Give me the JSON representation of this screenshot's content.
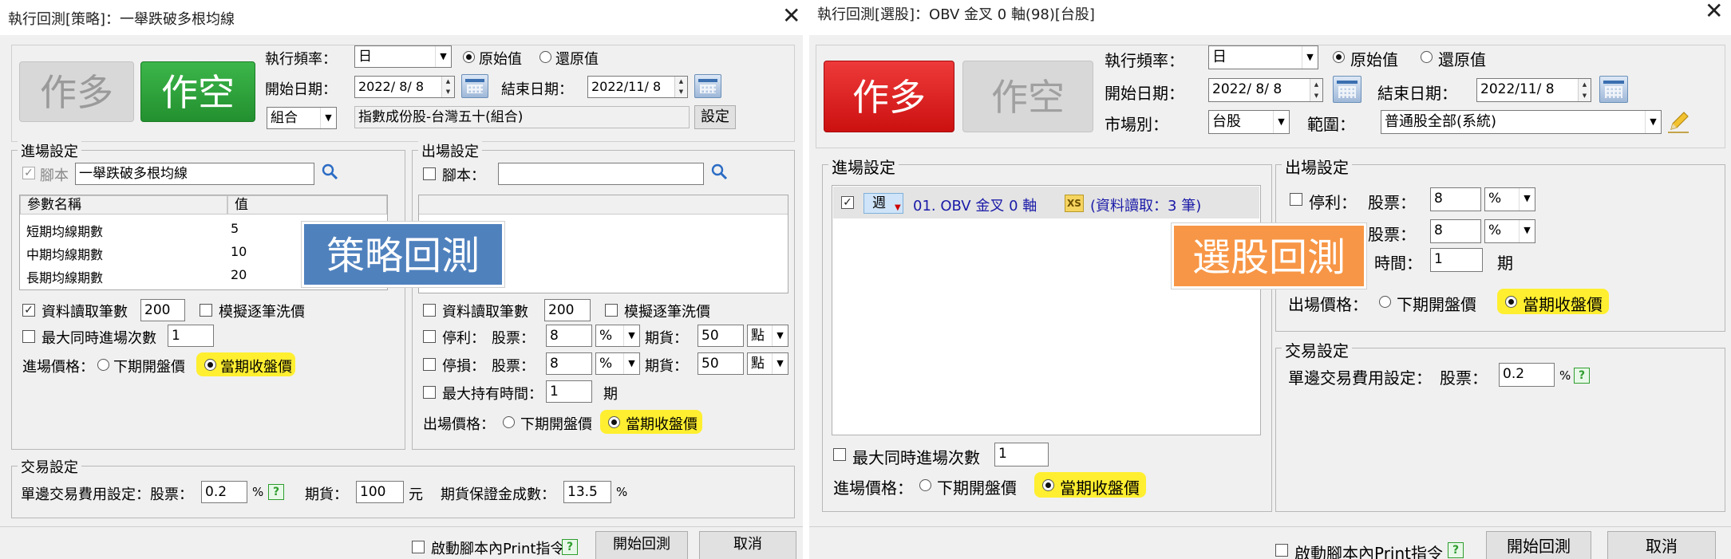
{
  "left": {
    "title": "執行回測[策略]：一舉跌破多根均線",
    "btn_long": "作多",
    "btn_short": "作空",
    "freq_label": "執行頻率：",
    "freq_value": "日",
    "radio_original": "原始值",
    "radio_restore": "還原值",
    "start_label": "開始日期：",
    "start_value": "2022/ 8/ 8",
    "end_label": "結束日期：",
    "end_value": "2022/11/ 8",
    "combo_value": "組合",
    "index_value": "指數成份股-台灣五十(組合)",
    "setting_btn": "設定",
    "entry": {
      "title": "進場設定",
      "script_label": "腳本",
      "script_value": "一舉跌破多根均線",
      "col_name": "參數名稱",
      "col_value": "值",
      "params": [
        {
          "name": "短期均線期數",
          "value": "5"
        },
        {
          "name": "中期均線期數",
          "value": "10"
        },
        {
          "name": "長期均線期數",
          "value": "20"
        }
      ],
      "read_label": "資料讀取筆數",
      "read_value": "200",
      "simulate_label": "模擬逐筆洗價",
      "max_label": "最大同時進場次數",
      "max_value": "1",
      "price_label": "進場價格：",
      "price_next": "下期開盤價",
      "price_close": "當期收盤價"
    },
    "exit": {
      "title": "出場設定",
      "script_label": "腳本：",
      "read_label": "資料讀取筆數",
      "read_value": "200",
      "simulate_label": "模擬逐筆洗價",
      "tp_label": "停利：",
      "sl_label": "停損：",
      "stock_label": "股票：",
      "futures_label": "期貨：",
      "tp_stock": "8",
      "sl_stock": "8",
      "pct_unit": "%",
      "tp_futures": "50",
      "sl_futures": "50",
      "point_unit": "點",
      "hold_label": "最大持有時間：",
      "hold_value": "1",
      "period_unit": "期",
      "price_label": "出場價格：",
      "price_next": "下期開盤價",
      "price_close": "當期收盤價"
    },
    "trade": {
      "title": "交易設定",
      "fee_label": "單邊交易費用設定：股票：",
      "fee_value": "0.2",
      "pct": "%",
      "help": "?",
      "futures_label": "期貨：",
      "futures_value": "100",
      "yuan": "元",
      "margin_label": "期貨保證金成數：",
      "margin_value": "13.5"
    },
    "print_label": "啟動腳本內Print指令",
    "start_btn": "開始回測",
    "cancel_btn": "取消",
    "badge": "策略回測"
  },
  "right": {
    "title": "執行回測[選股]：OBV 金叉 0 軸(98)[台股]",
    "btn_long": "作多",
    "btn_short": "作空",
    "freq_label": "執行頻率：",
    "freq_value": "日",
    "radio_original": "原始值",
    "radio_restore": "還原值",
    "start_label": "開始日期：",
    "start_value": "2022/ 8/ 8",
    "end_label": "結束日期：",
    "end_value": "2022/11/ 8",
    "market_label": "市場別：",
    "market_value": "台股",
    "range_label": "範圍：",
    "range_value": "普通股全部(系統)",
    "entry": {
      "title": "進場設定",
      "item_freq": "週",
      "item_text": "01. OBV 金叉 0 軸",
      "item_xs": "XS",
      "item_read": "(資料讀取：3 筆)",
      "max_label": "最大同時進場次數",
      "max_value": "1",
      "price_label": "進場價格：",
      "price_next": "下期開盤價",
      "price_close": "當期收盤價"
    },
    "exit": {
      "title": "出場設定",
      "tp_label": "停利：",
      "stock_label": "股票：",
      "tp_value": "8",
      "pct_unit": "%",
      "sl_stock_label": "股票：",
      "sl_value": "8",
      "hold_label": "時間：",
      "hold_value": "1",
      "period_unit": "期",
      "price_label": "出場價格：",
      "price_next": "下期開盤價",
      "price_close": "當期收盤價"
    },
    "trade": {
      "title": "交易設定",
      "fee_label": "單邊交易費用設定：",
      "stock_label": "股票：",
      "fee_value": "0.2",
      "pct": "%",
      "help": "?"
    },
    "print_label": "啟動腳本內Print指令",
    "start_btn": "開始回測",
    "cancel_btn": "取消",
    "badge": "選股回測"
  },
  "colors": {
    "badge_left": "#4f81bd",
    "badge_right": "#f79646",
    "green_btn": "#2e9e3a",
    "red_btn": "#d81a1a",
    "highlight": "#ffef30",
    "link_blue": "#1a1aa8"
  }
}
